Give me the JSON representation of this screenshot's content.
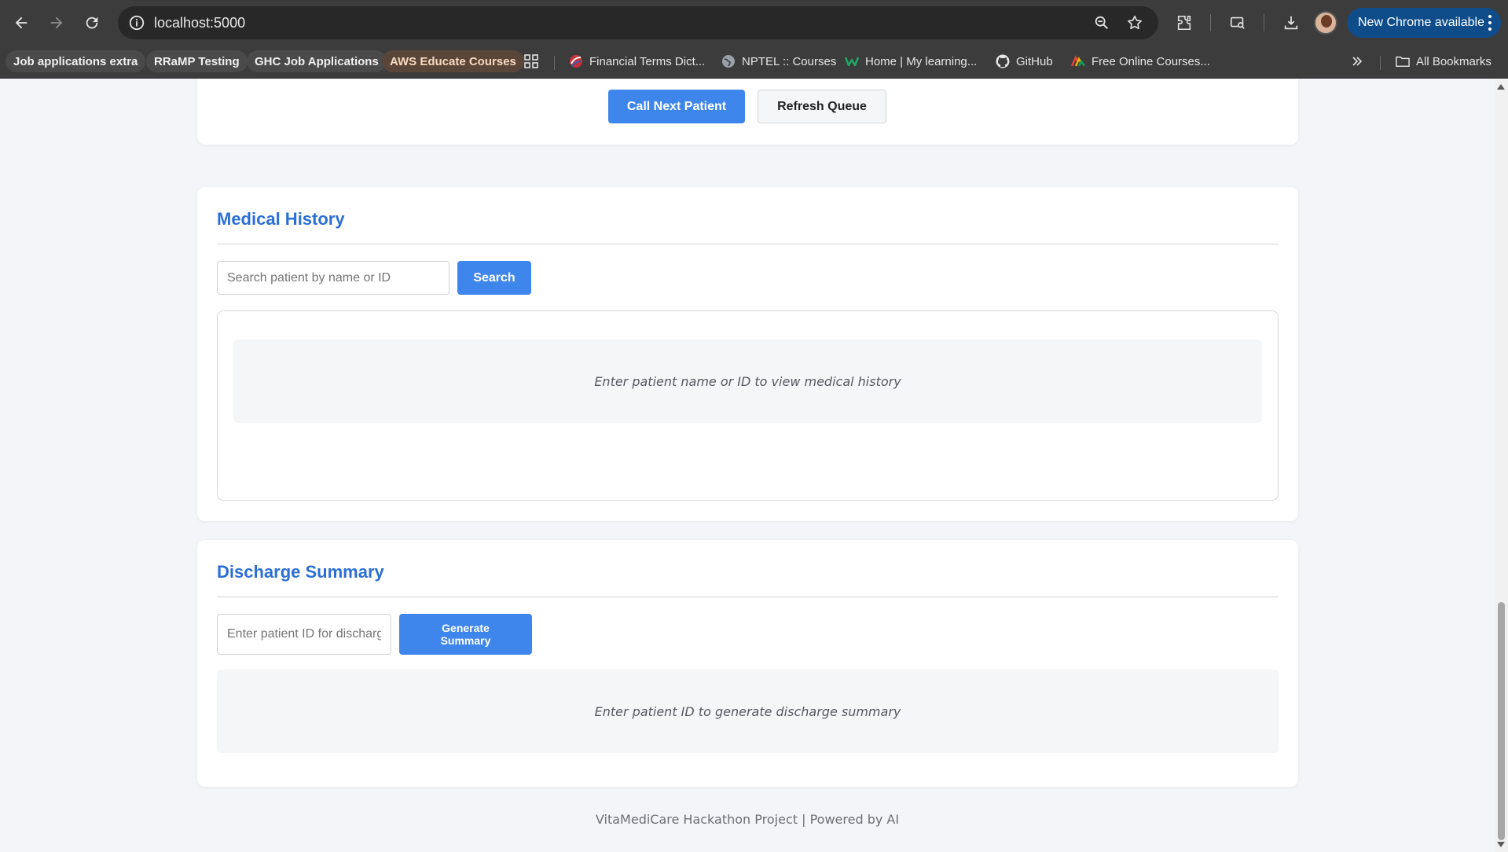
{
  "browser": {
    "url": "localhost:5000",
    "update_label": "New Chrome available",
    "bookmarks": [
      {
        "label": "Job applications extra"
      },
      {
        "label": "RRaMP Testing"
      },
      {
        "label": "GHC Job Applications"
      },
      {
        "label": "AWS Educate Courses"
      },
      {
        "label": "Financial Terms Dict..."
      },
      {
        "label": "NPTEL :: Courses"
      },
      {
        "label": "Home | My learning..."
      },
      {
        "label": "GitHub"
      },
      {
        "label": "Free Online Courses..."
      }
    ],
    "all_bookmarks_label": "All Bookmarks"
  },
  "queue": {
    "call_next_label": "Call Next Patient",
    "refresh_label": "Refresh Queue"
  },
  "medical_history": {
    "title": "Medical History",
    "search_placeholder": "Search patient by name or ID",
    "search_button": "Search",
    "empty_message": "Enter patient name or ID to view medical history"
  },
  "discharge": {
    "title": "Discharge Summary",
    "input_placeholder": "Enter patient ID for discharge",
    "generate_button": "Generate Summary",
    "empty_message": "Enter patient ID to generate discharge summary"
  },
  "footer": {
    "text": "VitaMediCare Hackathon Project | Powered by AI"
  },
  "colors": {
    "accent": "#3f86ec",
    "title": "#2b6fd6",
    "page_bg": "#f3f5f8"
  }
}
